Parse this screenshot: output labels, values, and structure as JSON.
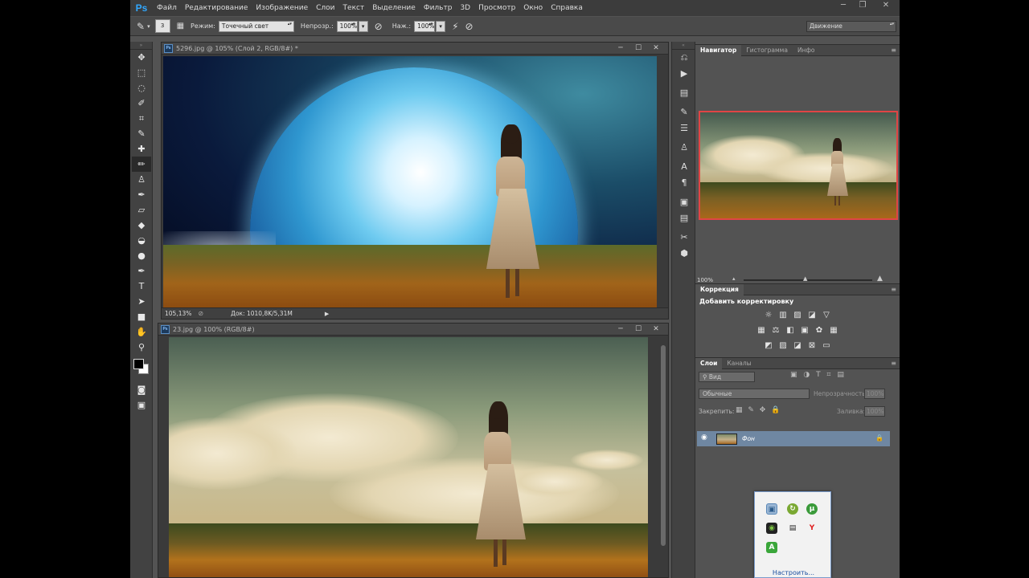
{
  "app": {
    "logo": "Ps",
    "menu": [
      "Файл",
      "Редактирование",
      "Изображение",
      "Слои",
      "Текст",
      "Выделение",
      "Фильтр",
      "3D",
      "Просмотр",
      "Окно",
      "Справка"
    ],
    "window_controls": [
      "─",
      "❐",
      "✕"
    ]
  },
  "options": {
    "brush_size": "3",
    "mode_label": "Режим:",
    "mode_value": "Точечный свет",
    "opacity_label": "Непрозр.:",
    "opacity_value": "100%",
    "pressure_label": "Наж.:",
    "pressure_value": "100%",
    "workspace": "Движение"
  },
  "doc1": {
    "title": "5296.jpg @ 105% (Слой 2, RGB/8#) *",
    "zoom": "105,13%",
    "doc_size": "Док: 1010,8K/5,31M"
  },
  "doc2": {
    "title": "23.jpg @ 100% (RGB/8#)"
  },
  "doc_controls": [
    "─",
    "☐",
    "✕"
  ],
  "navigator": {
    "tabs": [
      "Навигатор",
      "Гистограмма",
      "Инфо"
    ],
    "zoom": "100%"
  },
  "corrections": {
    "tab": "Коррекция",
    "title": "Добавить корректировку"
  },
  "layers": {
    "tabs": [
      "Слои",
      "Каналы"
    ],
    "filter_kind": "Вид",
    "blend_mode": "Обычные",
    "opacity_label": "Непрозрачность:",
    "opacity_value": "100%",
    "lock_label": "Закрепить:",
    "fill_label": "Заливка:",
    "fill_value": "100%",
    "layer_name": "Фон"
  },
  "tray": {
    "link": "Настроить..."
  },
  "colors": {
    "accent": "#31a8ff",
    "nav_frame": "#e04545",
    "layer_selected": "#6f87a2"
  }
}
